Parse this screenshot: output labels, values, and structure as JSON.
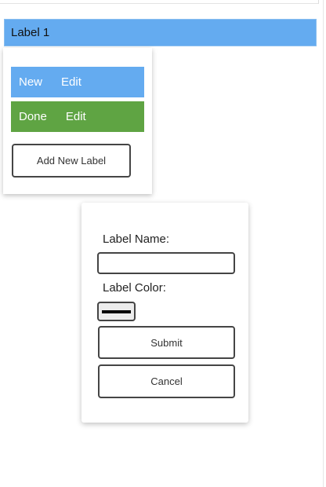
{
  "label_bar": {
    "text": "Label 1",
    "color": "#64abf0"
  },
  "menu": {
    "items": [
      {
        "status": "New",
        "action": "Edit",
        "color": "#64abf0"
      },
      {
        "status": "Done",
        "action": "Edit",
        "color": "#5fa443"
      }
    ],
    "add_button_label": "Add New Label"
  },
  "form": {
    "name_label": "Label Name:",
    "name_value": "",
    "color_label": "Label Color:",
    "color_value": "#000000",
    "submit_label": "Submit",
    "cancel_label": "Cancel"
  }
}
